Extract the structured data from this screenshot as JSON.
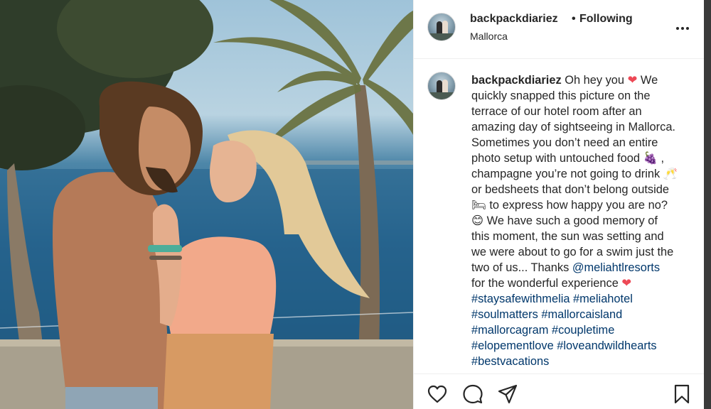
{
  "post": {
    "username": "backpackdiariez",
    "separator": "•",
    "follow_status": "Following",
    "location": "Mallorca"
  },
  "caption": {
    "username": "backpackdiariez",
    "lines": [
      " Oh hey you",
      "quickly snapped this picture on the",
      "terrace of our hotel room after an",
      "amazing day of sightseeing in Mallorca.",
      "Sometimes you don’t need an entire",
      "photo setup with untouched food",
      "champagne you’re not going to drink",
      "or bedsheets that don’t belong outside",
      "to express how happy you are no?",
      "We have such a good memory of",
      "this moment, the sun was setting and",
      "we were about to go for a swim just the",
      "two of us... Thanks",
      "for the wonderful experience"
    ],
    "word_we": "We",
    "comma": ",",
    "mention": "@meliahtlresorts",
    "hashtags": [
      "#staysafewithmelia #meliahotel",
      "#soulmatters #mallorcaisland",
      "#mallorcagram #coupletime",
      "#elopementlove #loveandwildhearts",
      "#bestvacations"
    ],
    "emoji": {
      "heart": "❤",
      "grapes": "🍇",
      "champagne": "🥂",
      "bed": "🛏",
      "smile": "😊"
    }
  },
  "icons": {
    "like": "heart-outline",
    "comment": "speech-bubble",
    "share": "paper-plane",
    "save": "bookmark",
    "more": "three-dots"
  },
  "colors": {
    "text": "#262626",
    "link": "#00376b",
    "heart": "#ed4956",
    "divider": "#efefef"
  }
}
